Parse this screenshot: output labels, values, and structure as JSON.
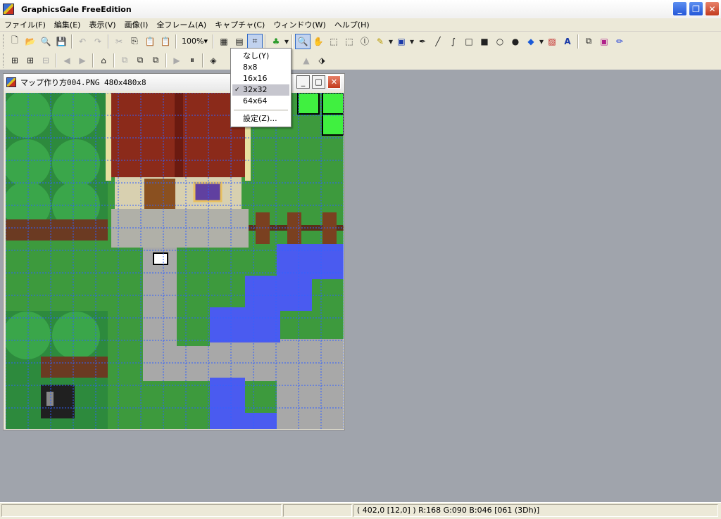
{
  "app": {
    "title": "GraphicsGale FreeEdition",
    "minimize": "_",
    "maximize": "❐",
    "close": "✕"
  },
  "menu": [
    "ファイル(F)",
    "編集(E)",
    "表示(V)",
    "画像(I)",
    "全フレーム(A)",
    "キャプチャ(C)",
    "ウィンドウ(W)",
    "ヘルプ(H)"
  ],
  "toolbar": {
    "zoom": "100%",
    "icons": [
      "new-file",
      "open-file",
      "zoom",
      "save",
      "undo",
      "redo",
      "cut",
      "copy",
      "paste",
      "paste-special"
    ]
  },
  "document": {
    "title": "マップ作り方004.PNG 480x480x8",
    "minimize": "_",
    "maximize": "□",
    "close": "✕"
  },
  "grid_menu": {
    "items": [
      {
        "label": "なし(Y)",
        "checked": false
      },
      {
        "label": "8x8",
        "checked": false
      },
      {
        "label": "16x16",
        "checked": false
      },
      {
        "label": "32x32",
        "checked": true
      },
      {
        "label": "64x64",
        "checked": false
      },
      {
        "label": "設定(Z)...",
        "checked": false
      }
    ],
    "check_mark": "✓"
  },
  "status": {
    "coords": "( 402,0 [12,0] ) R:168 G:090 B:046  [061 (3Dh)]"
  },
  "colors": {
    "grass": "#3d9a3d",
    "water": "#4a5bf0",
    "roof": "#8b2a1a",
    "path": "#a8a8a8",
    "grid": "#3060ff"
  }
}
